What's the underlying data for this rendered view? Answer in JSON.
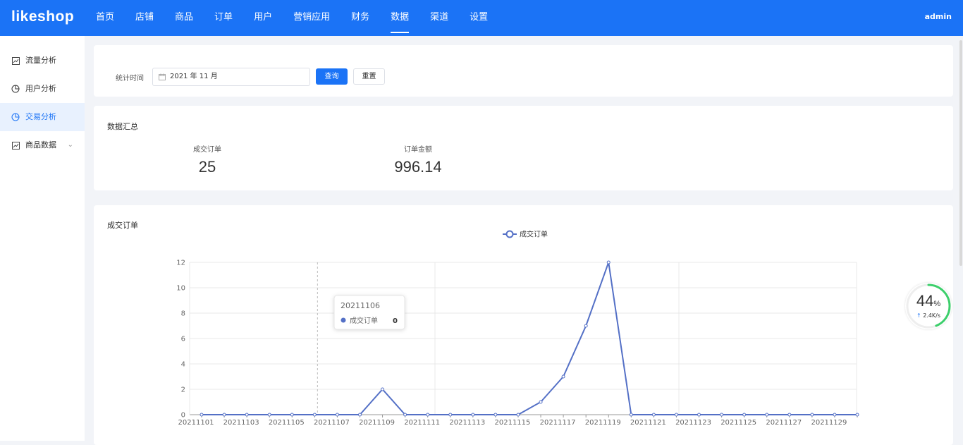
{
  "app": {
    "logo": "likeshop",
    "user": "admin"
  },
  "nav": {
    "items": [
      {
        "label": "首页",
        "active": false
      },
      {
        "label": "店铺",
        "active": false
      },
      {
        "label": "商品",
        "active": false
      },
      {
        "label": "订单",
        "active": false
      },
      {
        "label": "用户",
        "active": false
      },
      {
        "label": "营销应用",
        "active": false
      },
      {
        "label": "财务",
        "active": false
      },
      {
        "label": "数据",
        "active": true
      },
      {
        "label": "渠道",
        "active": false
      },
      {
        "label": "设置",
        "active": false
      }
    ]
  },
  "sidebar": {
    "items": [
      {
        "label": "流量分析",
        "icon": "line-chart-icon",
        "active": false
      },
      {
        "label": "用户分析",
        "icon": "pie-chart-icon",
        "active": false
      },
      {
        "label": "交易分析",
        "icon": "pie-chart-icon",
        "active": true
      },
      {
        "label": "商品数据",
        "icon": "line-chart-icon",
        "active": false,
        "expandable": true
      }
    ]
  },
  "filter": {
    "label": "统计时间",
    "date_value": "2021 年 11 月",
    "query_label": "查询",
    "reset_label": "重置"
  },
  "summary": {
    "title": "数据汇总",
    "stats": [
      {
        "label": "成交订单",
        "value": "25"
      },
      {
        "label": "订单金额",
        "value": "996.14"
      }
    ]
  },
  "chart_card": {
    "title": "成交订单"
  },
  "chart_data": {
    "type": "line",
    "legend": "成交订单",
    "legend_position": "top-center",
    "x": [
      "20211101",
      "20211102",
      "20211103",
      "20211104",
      "20211105",
      "20211106",
      "20211107",
      "20211108",
      "20211109",
      "20211110",
      "20211111",
      "20211112",
      "20211113",
      "20211114",
      "20211115",
      "20211116",
      "20211117",
      "20211118",
      "20211119",
      "20211120",
      "20211121",
      "20211122",
      "20211123",
      "20211124",
      "20211125",
      "20211126",
      "20211127",
      "20211128",
      "20211129",
      "20211130"
    ],
    "x_tick_labels": [
      "20211101",
      "20211103",
      "20211105",
      "20211107",
      "20211109",
      "20211111",
      "20211113",
      "20211115",
      "20211117",
      "20211119",
      "20211121",
      "20211123",
      "20211125",
      "20211127",
      "20211129"
    ],
    "series": [
      {
        "name": "成交订单",
        "color": "#5470c6",
        "values": [
          0,
          0,
          0,
          0,
          0,
          0,
          0,
          0,
          2,
          0,
          0,
          0,
          0,
          0,
          0,
          1,
          3,
          7,
          12,
          0,
          0,
          0,
          0,
          0,
          0,
          0,
          0,
          0,
          0,
          0
        ]
      }
    ],
    "ylim": [
      0,
      12
    ],
    "y_ticks": [
      0,
      2,
      4,
      6,
      8,
      10,
      12
    ],
    "grid": true,
    "tooltip": {
      "date": "20211106",
      "series": "成交订单",
      "value": "0"
    }
  },
  "monitor": {
    "percent": "44",
    "unit": "%",
    "speed": "2.4K/s"
  }
}
